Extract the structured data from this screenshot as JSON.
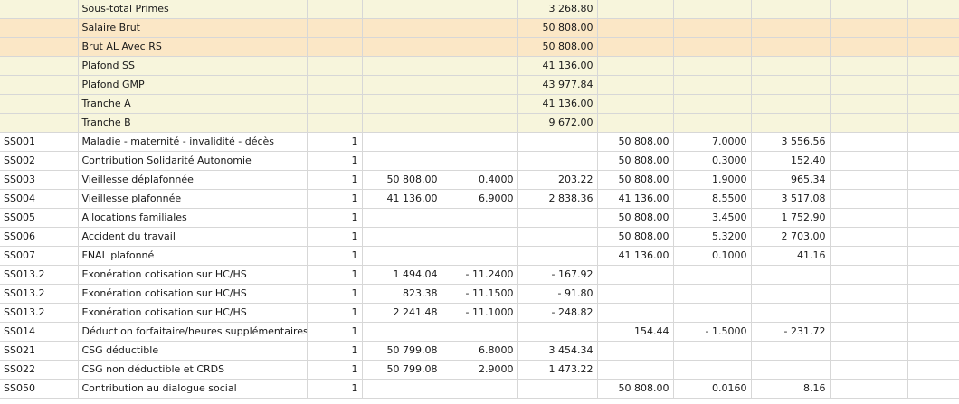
{
  "summary_rows": [
    {
      "label": "Sous-total Primes",
      "value": "3 268.80",
      "highlight": false,
      "indent": false
    },
    {
      "label": "Salaire Brut",
      "value": "50 808.00",
      "highlight": true,
      "indent": false
    },
    {
      "label": "Brut AL Avec RS",
      "value": "50 808.00",
      "highlight": true,
      "indent": false
    },
    {
      "label": "Plafond SS",
      "value": "41 136.00",
      "highlight": false,
      "indent": true
    },
    {
      "label": "Plafond GMP",
      "value": "43 977.84",
      "highlight": false,
      "indent": true
    },
    {
      "label": "Tranche A",
      "value": "41 136.00",
      "highlight": false,
      "indent": true
    },
    {
      "label": "Tranche B",
      "value": "9 672.00",
      "highlight": false,
      "indent": true
    }
  ],
  "lines": [
    {
      "code": "SS001",
      "label": "Maladie - maternité - invalidité - décès",
      "qty": "1",
      "base_sal": "",
      "taux_sal": "",
      "montant_sal": "",
      "base_pat": "50 808.00",
      "taux_pat": "7.0000",
      "montant_pat": "3 556.56"
    },
    {
      "code": "SS002",
      "label": "Contribution Solidarité Autonomie",
      "qty": "1",
      "base_sal": "",
      "taux_sal": "",
      "montant_sal": "",
      "base_pat": "50 808.00",
      "taux_pat": "0.3000",
      "montant_pat": "152.40"
    },
    {
      "code": "SS003",
      "label": "Vieillesse déplafonnée",
      "qty": "1",
      "base_sal": "50 808.00",
      "taux_sal": "0.4000",
      "montant_sal": "203.22",
      "base_pat": "50 808.00",
      "taux_pat": "1.9000",
      "montant_pat": "965.34"
    },
    {
      "code": "SS004",
      "label": "Vieillesse plafonnée",
      "qty": "1",
      "base_sal": "41 136.00",
      "taux_sal": "6.9000",
      "montant_sal": "2 838.36",
      "base_pat": "41 136.00",
      "taux_pat": "8.5500",
      "montant_pat": "3 517.08"
    },
    {
      "code": "SS005",
      "label": "Allocations familiales",
      "qty": "1",
      "base_sal": "",
      "taux_sal": "",
      "montant_sal": "",
      "base_pat": "50 808.00",
      "taux_pat": "3.4500",
      "montant_pat": "1 752.90"
    },
    {
      "code": "SS006",
      "label": "Accident du travail",
      "qty": "1",
      "base_sal": "",
      "taux_sal": "",
      "montant_sal": "",
      "base_pat": "50 808.00",
      "taux_pat": "5.3200",
      "montant_pat": "2 703.00"
    },
    {
      "code": "SS007",
      "label": "FNAL plafonné",
      "qty": "1",
      "base_sal": "",
      "taux_sal": "",
      "montant_sal": "",
      "base_pat": "41 136.00",
      "taux_pat": "0.1000",
      "montant_pat": "41.16"
    },
    {
      "code": "SS013.2",
      "label": "Exonération cotisation sur HC/HS",
      "qty": "1",
      "base_sal": "1 494.04",
      "taux_sal": "- 11.2400",
      "montant_sal": "- 167.92",
      "base_pat": "",
      "taux_pat": "",
      "montant_pat": ""
    },
    {
      "code": "SS013.2",
      "label": "Exonération cotisation sur HC/HS",
      "qty": "1",
      "base_sal": "823.38",
      "taux_sal": "- 11.1500",
      "montant_sal": "- 91.80",
      "base_pat": "",
      "taux_pat": "",
      "montant_pat": ""
    },
    {
      "code": "SS013.2",
      "label": "Exonération cotisation sur HC/HS",
      "qty": "1",
      "base_sal": "2 241.48",
      "taux_sal": "- 11.1000",
      "montant_sal": "- 248.82",
      "base_pat": "",
      "taux_pat": "",
      "montant_pat": ""
    },
    {
      "code": "SS014",
      "label": "Déduction forfaitaire/heures supplémentaires",
      "qty": "1",
      "base_sal": "",
      "taux_sal": "",
      "montant_sal": "",
      "base_pat": "154.44",
      "taux_pat": "- 1.5000",
      "montant_pat": "- 231.72"
    },
    {
      "code": "SS021",
      "label": "CSG déductible",
      "qty": "1",
      "base_sal": "50 799.08",
      "taux_sal": "6.8000",
      "montant_sal": "3 454.34",
      "base_pat": "",
      "taux_pat": "",
      "montant_pat": ""
    },
    {
      "code": "SS022",
      "label": "CSG non déductible et CRDS",
      "qty": "1",
      "base_sal": "50 799.08",
      "taux_sal": "2.9000",
      "montant_sal": "1 473.22",
      "base_pat": "",
      "taux_pat": "",
      "montant_pat": ""
    },
    {
      "code": "SS050",
      "label": "Contribution au dialogue social",
      "qty": "1",
      "base_sal": "",
      "taux_sal": "",
      "montant_sal": "",
      "base_pat": "50 808.00",
      "taux_pat": "0.0160",
      "montant_pat": "8.16"
    }
  ]
}
